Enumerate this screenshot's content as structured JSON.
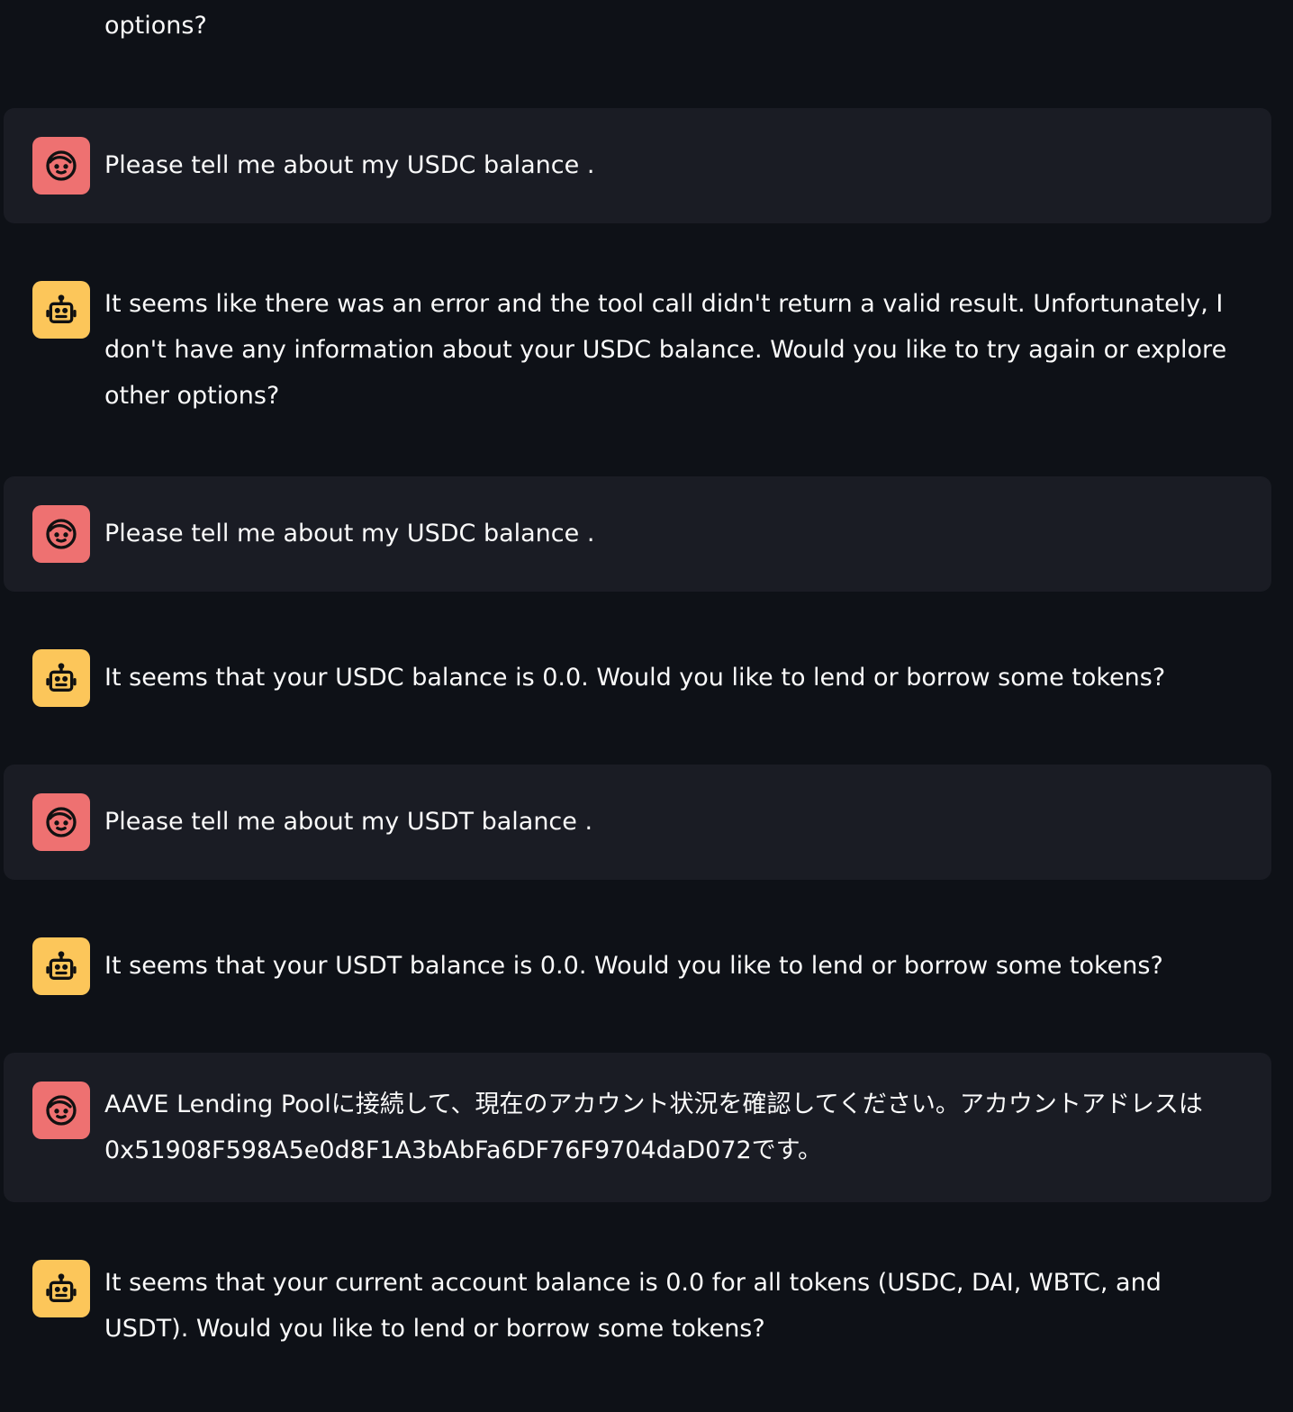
{
  "chat": {
    "partial_top_text": "options?",
    "messages": [
      {
        "role": "user",
        "icon": "user-face-icon",
        "text": "Please tell me about my USDC balance ."
      },
      {
        "role": "assistant",
        "icon": "robot-icon",
        "text": "It seems like there was an error and the tool call didn't return a valid result. Unfortunately, I don't have any information about your USDC balance. Would you like to try again or explore other options?"
      },
      {
        "role": "user",
        "icon": "user-face-icon",
        "text": "Please tell me about my USDC balance ."
      },
      {
        "role": "assistant",
        "icon": "robot-icon",
        "text": "It seems that your USDC balance is 0.0. Would you like to lend or borrow some tokens?"
      },
      {
        "role": "user",
        "icon": "user-face-icon",
        "text": "Please tell me about my USDT balance ."
      },
      {
        "role": "assistant",
        "icon": "robot-icon",
        "text": "It seems that your USDT balance is 0.0. Would you like to lend or borrow some tokens?"
      },
      {
        "role": "user",
        "icon": "user-face-icon",
        "text": "AAVE Lending Poolに接続して、現在のアカウント状況を確認してください。アカウントアドレスは0x51908F598A5e0d8F1A3bAbFa6DF76F9704daD072です。"
      },
      {
        "role": "assistant",
        "icon": "robot-icon",
        "text": "It seems that your current account balance is 0.0 for all tokens (USDC, DAI, WBTC, and USDT). Would you like to lend or borrow some tokens?"
      }
    ]
  },
  "colors": {
    "background": "#0e1117",
    "user_bubble": "#1a1c24",
    "user_avatar": "#ee7171",
    "assistant_avatar": "#fcc65a",
    "text": "#fafafa"
  }
}
